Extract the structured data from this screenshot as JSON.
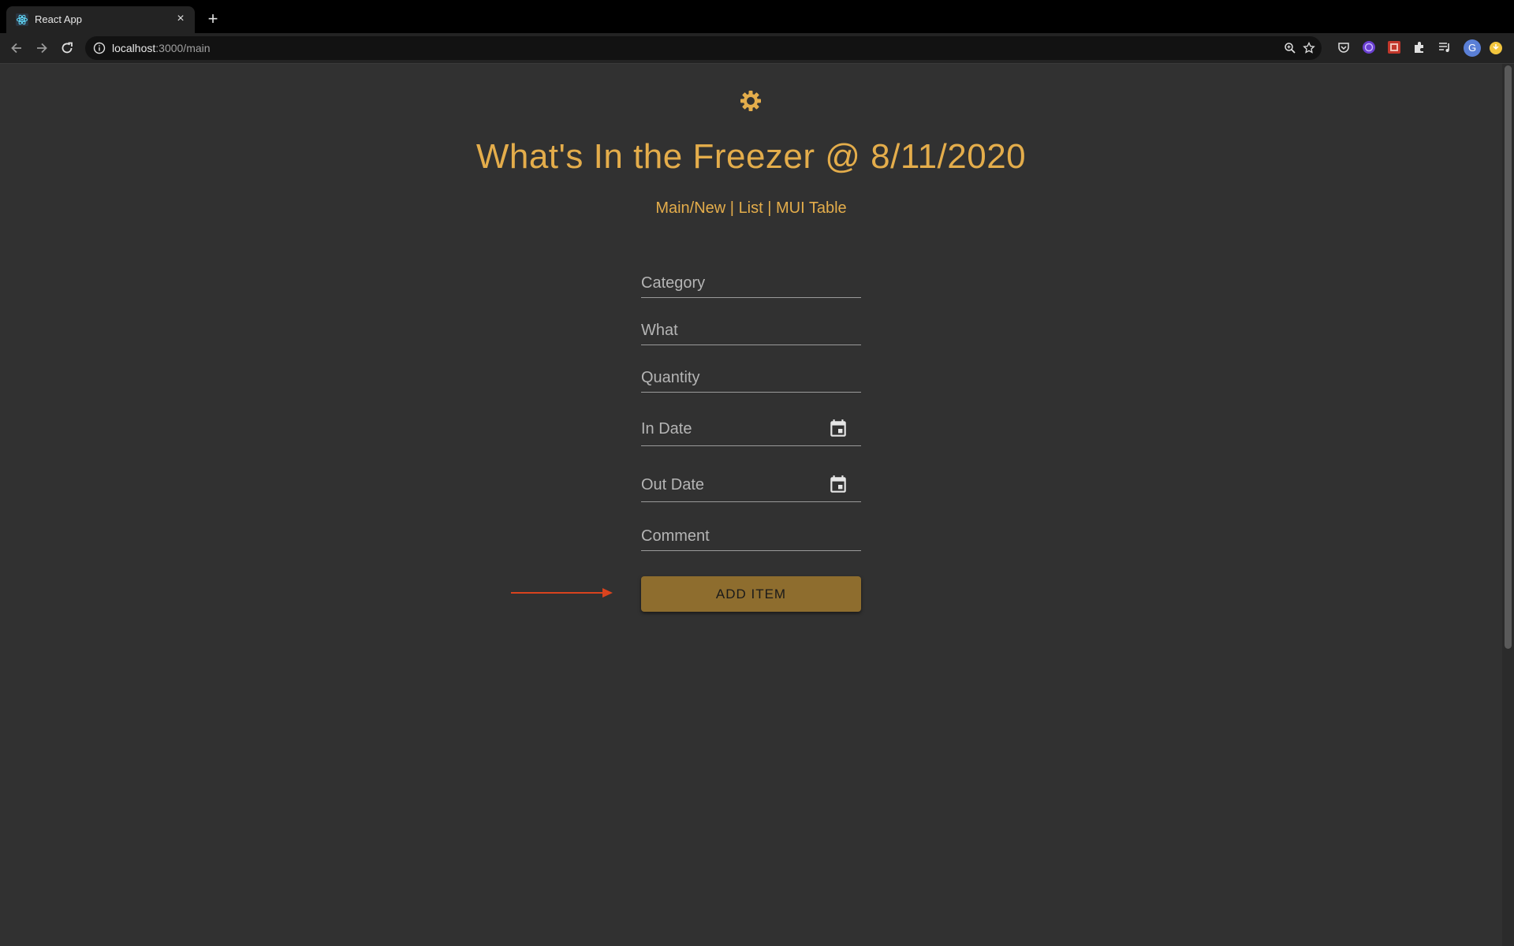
{
  "browser": {
    "tab_title": "React App",
    "tab_close": "×",
    "new_tab": "+",
    "url_host": "localhost",
    "url_rest": ":3000/main",
    "profile_initial": "G"
  },
  "page": {
    "title": "What's In the Freezer @ 8/11/2020",
    "nav": {
      "main": "Main/New",
      "sep1": " | ",
      "list": "List",
      "sep2": " | ",
      "mui_table": "MUI Table"
    },
    "form": {
      "category_placeholder": "Category",
      "what_placeholder": "What",
      "quantity_placeholder": "Quantity",
      "in_date_placeholder": "In Date",
      "out_date_placeholder": "Out Date",
      "comment_placeholder": "Comment",
      "submit_label": "ADD ITEM"
    }
  },
  "colors": {
    "accent": "#e4ad4b",
    "button": "#8e6d2e",
    "background": "#313131",
    "annotation_arrow": "#d9431e"
  },
  "icons": [
    "react-favicon-icon",
    "back-icon",
    "forward-icon",
    "reload-icon",
    "info-icon",
    "zoom-icon",
    "star-icon",
    "pocket-icon",
    "extension-purple-icon",
    "extension-red-icon",
    "puzzle-icon",
    "reading-list-icon",
    "avatar",
    "update-icon",
    "theme-toggle-icon",
    "calendar-icon"
  ]
}
